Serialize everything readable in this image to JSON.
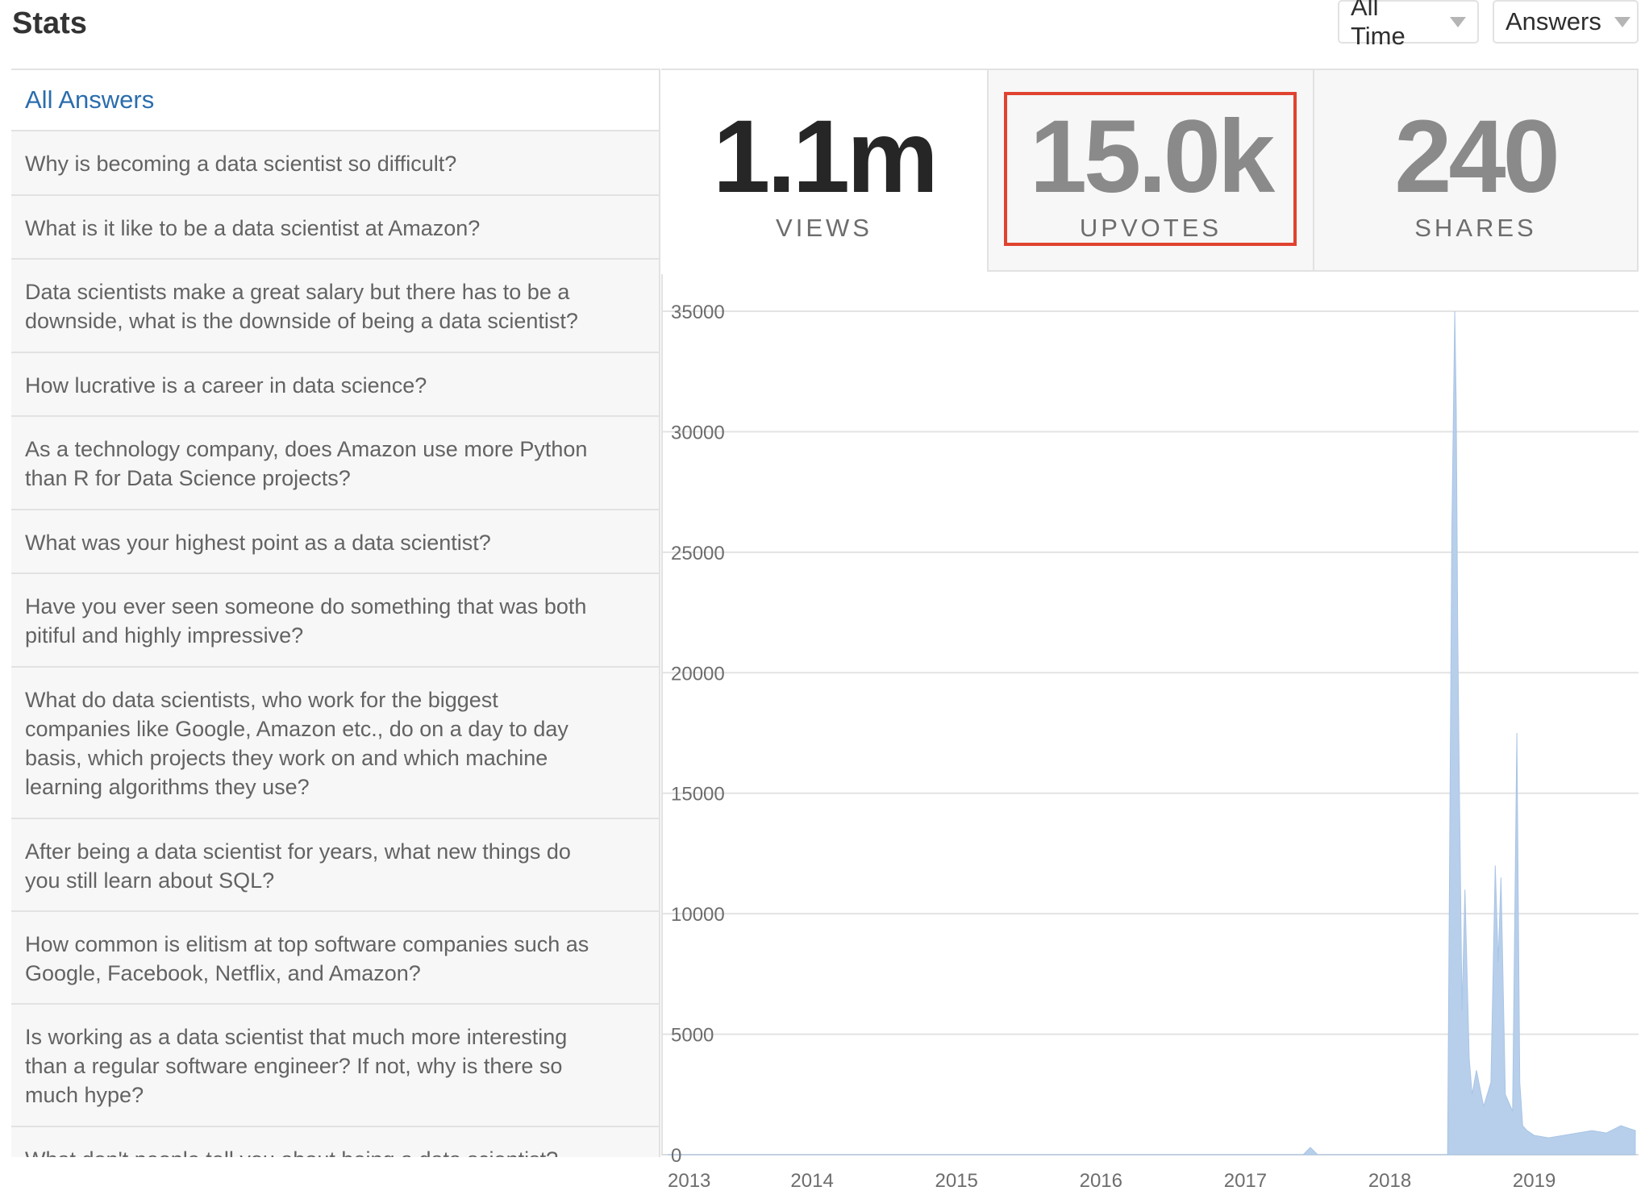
{
  "header": {
    "title": "Stats",
    "time_filter": "All Time",
    "type_filter": "Answers"
  },
  "answers": {
    "header": "All Answers",
    "items": [
      "Why is becoming a data scientist so difficult?",
      "What is it like to be a data scientist at Amazon?",
      "Data scientists make a great salary but there has to be a downside, what is the downside of being a data scientist?",
      "How lucrative is a career in data science?",
      "As a technology company, does Amazon use more Python than R for Data Science projects?",
      "What was your highest point as a data scientist?",
      "Have you ever seen someone do something that was both pitiful and highly impressive?",
      "What do data scientists, who work for the biggest companies like Google, Amazon etc., do on a day to day basis, which projects they work on and which machine learning algorithms they use?",
      "After being a data scientist for years, what new things do you still learn about SQL?",
      "How common is elitism at top software companies such as Google, Facebook, Netflix, and Amazon?",
      "Is working as a data scientist that much more interesting than a regular software engineer? If not, why is there so much hype?",
      "What don't people tell you about being a data scientist?"
    ]
  },
  "stats": {
    "views": {
      "value": "1.1m",
      "label": "VIEWS"
    },
    "upvotes": {
      "value": "15.0k",
      "label": "UPVOTES"
    },
    "shares": {
      "value": "240",
      "label": "SHARES"
    }
  },
  "colors": {
    "link": "#2b6dad",
    "highlight": "#e0432f",
    "series": "#b7cfea"
  },
  "chart_data": {
    "type": "area",
    "title": "",
    "xlabel": "",
    "ylabel": "",
    "ylim": [
      0,
      35000
    ],
    "xlim": [
      2013.0,
      2019.7
    ],
    "yticks": [
      "0",
      "5000",
      "10000",
      "15000",
      "20000",
      "25000",
      "30000",
      "35000"
    ],
    "xticks": [
      "2013",
      "2014",
      "2015",
      "2016",
      "2017",
      "2018",
      "2019"
    ],
    "grid": true,
    "series": [
      {
        "x": [
          2013.0,
          2017.4,
          2017.45,
          2017.5,
          2018.4,
          2018.43,
          2018.45,
          2018.46,
          2018.47,
          2018.48,
          2018.5,
          2018.52,
          2018.55,
          2018.57,
          2018.6,
          2018.65,
          2018.7,
          2018.73,
          2018.75,
          2018.77,
          2018.8,
          2018.85,
          2018.88,
          2018.9,
          2018.92,
          2018.95,
          2019.0,
          2019.1,
          2019.2,
          2019.3,
          2019.4,
          2019.5,
          2019.6,
          2019.7
        ],
        "y": [
          0,
          0,
          300,
          0,
          0,
          26000,
          35000,
          31000,
          22000,
          16000,
          6000,
          11000,
          4000,
          2500,
          3500,
          2000,
          3000,
          12000,
          8000,
          11500,
          2500,
          1800,
          17500,
          3000,
          1200,
          1000,
          800,
          700,
          800,
          900,
          1000,
          900,
          1200,
          1000
        ]
      }
    ]
  }
}
